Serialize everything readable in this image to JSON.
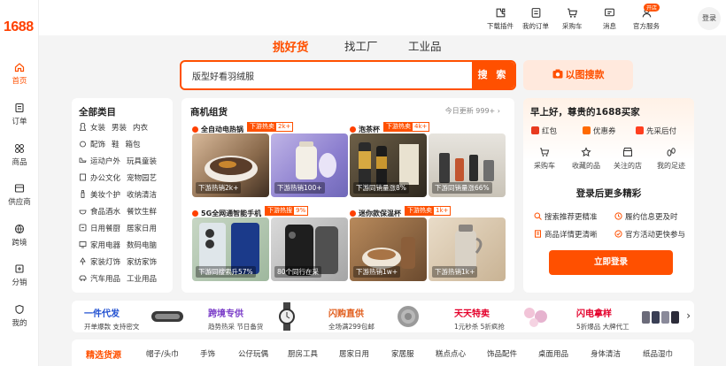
{
  "brand": {
    "logo": "1688",
    "color": "#ff5000"
  },
  "sidebar": {
    "items": [
      {
        "label": "首页",
        "icon": "home-icon",
        "active": true
      },
      {
        "label": "订单",
        "icon": "order-icon"
      },
      {
        "label": "商品",
        "icon": "goods-icon"
      },
      {
        "label": "供应商",
        "icon": "supplier-icon"
      },
      {
        "label": "跨境",
        "icon": "cross-border-icon"
      },
      {
        "label": "分销",
        "icon": "distribution-icon"
      },
      {
        "label": "我的",
        "icon": "my-icon"
      }
    ]
  },
  "topbar": {
    "items": [
      {
        "label": "下载插件",
        "icon": "plugin-icon"
      },
      {
        "label": "我的订单",
        "icon": "order-icon"
      },
      {
        "label": "采购车",
        "icon": "cart-icon"
      },
      {
        "label": "消息",
        "icon": "message-icon"
      },
      {
        "label": "官方服务",
        "icon": "service-icon",
        "badge": "开店"
      }
    ],
    "login": "登录"
  },
  "main_tabs": [
    "挑好货",
    "找工厂",
    "工业品"
  ],
  "search": {
    "value": "版型好看羽绒服",
    "button": "搜 索",
    "image_search": "以图搜款"
  },
  "categories": {
    "title": "全部类目",
    "rows": [
      [
        "女装",
        "男装",
        "内衣"
      ],
      [
        "配饰",
        "鞋",
        "箱包"
      ],
      [
        "运动户外",
        "玩具童装"
      ],
      [
        "办公文化",
        "宠物园艺"
      ],
      [
        "美妆个护",
        "收纳清洁"
      ],
      [
        "食品酒水",
        "餐饮生鲜"
      ],
      [
        "日用餐厨",
        "居家日用"
      ],
      [
        "家用电器",
        "数码电脑"
      ],
      [
        "家装灯饰",
        "家纺家饰"
      ],
      [
        "汽车用品",
        "工业用品"
      ]
    ]
  },
  "business": {
    "title": "商机组货",
    "updated": "今日更新 999+",
    "cards": [
      {
        "title": "全自动电热锅",
        "tag": "下游热卖",
        "count": "2k+",
        "photos": [
          {
            "caption": "下游热销2k+"
          },
          {
            "caption": "下游热销100+"
          }
        ]
      },
      {
        "title": "泡茶杯",
        "tag": "下游热卖",
        "count": "4k+",
        "photos": [
          {
            "caption": "下游同销量涨8%"
          },
          {
            "caption": "下游同销量涨66%"
          }
        ]
      },
      {
        "title": "5G全网通智能手机",
        "tag": "下游热搜",
        "count": "9%",
        "photos": [
          {
            "caption": "下游同搜索升57%"
          },
          {
            "caption": "80个同行在采"
          }
        ]
      },
      {
        "title": "迷你款保温杯",
        "tag": "下游热卖",
        "count": "1k+",
        "photos": [
          {
            "caption": "下游热销1w+"
          },
          {
            "caption": "下游热销1k+"
          }
        ]
      }
    ]
  },
  "account": {
    "welcome": "早上好，尊贵的1688买家",
    "perks": [
      "红包",
      "优惠券",
      "先采后付"
    ],
    "quick": [
      {
        "label": "采购车",
        "icon": "cart-icon"
      },
      {
        "label": "收藏的品",
        "icon": "favorite-icon"
      },
      {
        "label": "关注的店",
        "icon": "store-icon"
      },
      {
        "label": "我的足迹",
        "icon": "footprint-icon"
      }
    ],
    "login_more": "登录后更多精彩",
    "features": [
      "搜索推荐更精准",
      "履约信息更及时",
      "商品详情更清晰",
      "官方活动更快参与"
    ],
    "login_button": "立即登录"
  },
  "services": [
    {
      "title": "一件代发",
      "sub": "开单爆款 支持密文",
      "color": "#1f4fd1"
    },
    {
      "title": "跨境专供",
      "sub": "趋势热采 节日备货",
      "color": "#7a3cc8"
    },
    {
      "title": "闪购直供",
      "sub": "全场满299包邮",
      "color": "#e05a18"
    },
    {
      "title": "天天特卖",
      "sub": "1元秒杀 5折疯抢",
      "color": "#e4002b"
    },
    {
      "title": "闪电拿样",
      "sub": "5折爆品 大牌代工",
      "color": "#e4002b"
    }
  ],
  "bottom_nav": [
    "精选货源",
    "帽子/头巾",
    "手饰",
    "公仔玩偶",
    "厨房工具",
    "居家日用",
    "家居服",
    "糕点点心",
    "饰品配件",
    "桌面用品",
    "身体清洁",
    "纸品湿巾"
  ]
}
